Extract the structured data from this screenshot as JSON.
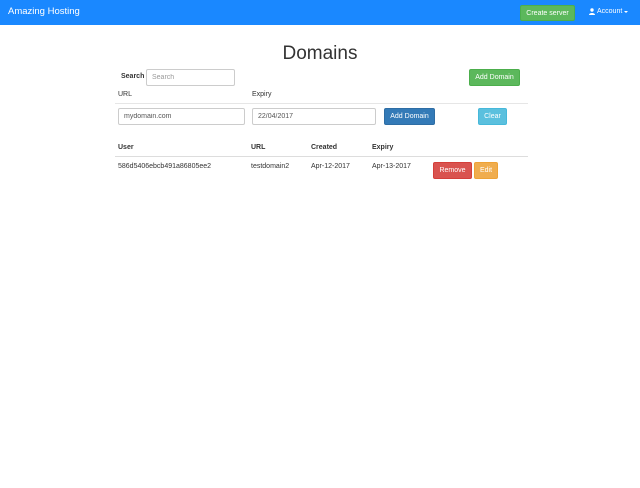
{
  "navbar": {
    "brand": "Amazing Hosting",
    "create_server_label": "Create server",
    "account_label": "Account",
    "account_icon": "user-icon",
    "colors": {
      "navbar_bg": "#1a88ff"
    }
  },
  "page": {
    "title": "Domains"
  },
  "search": {
    "label": "Search",
    "placeholder": "Search",
    "value": ""
  },
  "add_domain_top_label": "Add Domain",
  "form": {
    "url_label": "URL",
    "expiry_label": "Expiry",
    "url_value": "mydomain.com",
    "expiry_value": "22/04/2017",
    "add_label": "Add Domain",
    "clear_label": "Clear"
  },
  "table": {
    "headers": [
      "User",
      "URL",
      "Created",
      "Expiry"
    ],
    "rows": [
      {
        "user": "586d5406ebcb491a86805ee2",
        "url": "testdomain2",
        "created": "Apr-12-2017",
        "expiry": "Apr-13-2017",
        "remove_label": "Remove",
        "edit_label": "Edit"
      }
    ]
  },
  "colors": {
    "success": "#5cb85c",
    "primary": "#337ab7",
    "info": "#5bc0de",
    "danger": "#d9534f",
    "warning": "#f0ad4e"
  }
}
